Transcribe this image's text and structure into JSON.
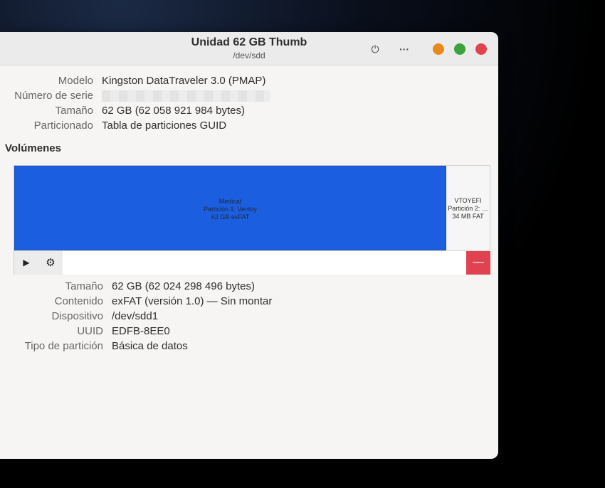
{
  "window": {
    "title": "Unidad 62 GB Thumb",
    "subtitle": "/dev/sdd",
    "power_icon": "⏻",
    "menu_icon": "···",
    "controls": {
      "minimize_color": "#e8891d",
      "maximize_color": "#3aa339",
      "close_color": "#e0424f"
    }
  },
  "drive": [
    {
      "label": "Modelo",
      "value": "Kingston DataTraveler 3.0 (PMAP)"
    },
    {
      "label": "Número de serie",
      "value": ""
    },
    {
      "label": "Tamaño",
      "value": "62 GB (62 058 921 984 bytes)"
    },
    {
      "label": "Particionado",
      "value": "Tabla de particiones GUID"
    }
  ],
  "volumes": {
    "title": "Volúmenes",
    "partitions": [
      {
        "lines": [
          "Medicat",
          "Partición 1: Ventoy",
          "62 GB exFAT"
        ],
        "color": "#1c5ee0"
      },
      {
        "lines": [
          "VTOYEFI",
          "Partición 2: …",
          "34 MB FAT"
        ],
        "color": "#f6f6f6"
      }
    ],
    "toolbar": {
      "play_icon": "▶",
      "gears_icon": "⚙",
      "delete_icon": "—"
    }
  },
  "partition_details": [
    {
      "label": "Tamaño",
      "value": "62 GB (62 024 298 496 bytes)"
    },
    {
      "label": "Contenido",
      "value": "exFAT (versión 1.0) — Sin montar"
    },
    {
      "label": "Dispositivo",
      "value": "/dev/sdd1"
    },
    {
      "label": "UUID",
      "value": "EDFB-8EE0"
    },
    {
      "label": "Tipo de partición",
      "value": "Básica de datos"
    }
  ]
}
